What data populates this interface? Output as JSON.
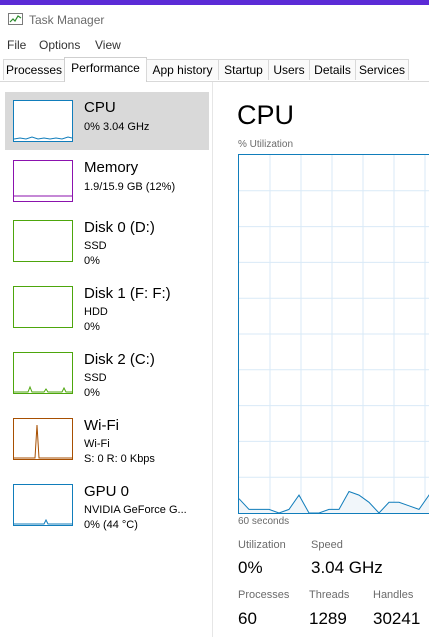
{
  "window": {
    "title": "Task Manager",
    "accent": "#5b2bd6"
  },
  "menu": [
    "File",
    "Options",
    "View"
  ],
  "tabs": [
    "Processes",
    "Performance",
    "App history",
    "Startup",
    "Users",
    "Details",
    "Services"
  ],
  "active_tab": "Performance",
  "sidebar": {
    "items": [
      {
        "name": "CPU",
        "lines": [
          "0% 3.04 GHz"
        ],
        "color": "#117dbb"
      },
      {
        "name": "Memory",
        "lines": [
          "1.9/15.9 GB (12%)"
        ],
        "color": "#8b12ae"
      },
      {
        "name": "Disk 0 (D:)",
        "lines": [
          "SSD",
          "0%"
        ],
        "color": "#4da60c"
      },
      {
        "name": "Disk 1 (F: F:)",
        "lines": [
          "HDD",
          "0%"
        ],
        "color": "#4da60c"
      },
      {
        "name": "Disk 2 (C:)",
        "lines": [
          "SSD",
          "0%"
        ],
        "color": "#4da60c"
      },
      {
        "name": "Wi-Fi",
        "lines": [
          "Wi-Fi",
          "S: 0 R: 0 Kbps"
        ],
        "color": "#a74f01"
      },
      {
        "name": "GPU 0",
        "lines": [
          "NVIDIA GeForce G...",
          "0% (44 °C)"
        ],
        "color": "#117dbb"
      }
    ]
  },
  "main": {
    "title": "CPU",
    "graph_label": "% Utilization",
    "x_label": "60 seconds",
    "graph_color": "#117dbb",
    "stats": {
      "utilization_label": "Utilization",
      "utilization": "0%",
      "speed_label": "Speed",
      "speed": "3.04 GHz",
      "processes_label": "Processes",
      "processes": "60",
      "threads_label": "Threads",
      "threads": "1289",
      "handles_label": "Handles",
      "handles": "30241"
    }
  },
  "chart_data": {
    "type": "area",
    "title": "CPU",
    "ylabel": "% Utilization",
    "xlabel": "60 seconds",
    "ylim": [
      0,
      100
    ],
    "series": [
      {
        "values": [
          4,
          1,
          1,
          1,
          0,
          1,
          5,
          0,
          0,
          1,
          1,
          6,
          5,
          3,
          0,
          3,
          3,
          2,
          1,
          5,
          1
        ]
      }
    ]
  }
}
